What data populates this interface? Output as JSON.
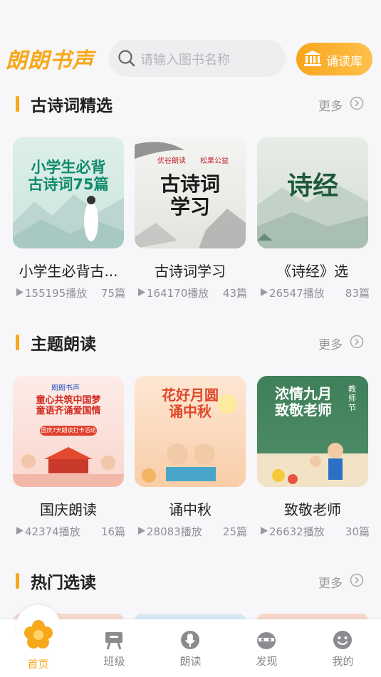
{
  "header": {
    "logo": "朗朗书声",
    "search_placeholder": "请输入图书名称",
    "library_label": "诵读库"
  },
  "sections": [
    {
      "title": "古诗词精选",
      "more": "更多",
      "books": [
        {
          "title": "小学生必背古...",
          "plays": "155195播放",
          "count": "75篇",
          "cover_text": "小学生必背\n古诗词75篇"
        },
        {
          "title": "古诗词学习",
          "plays": "164170播放",
          "count": "43篇",
          "cover_text": "古诗词\n学习",
          "cover_brand_a": "优谷朗读",
          "cover_brand_b": "松果公益"
        },
        {
          "title": "《诗经》选",
          "plays": "26547播放",
          "count": "83篇",
          "cover_text": "诗经"
        }
      ]
    },
    {
      "title": "主题朗读",
      "more": "更多",
      "books": [
        {
          "title": "国庆朗读",
          "plays": "42374播放",
          "count": "16篇",
          "cover_text": "童心共筑中国梦\n童语齐诵爱国情",
          "cover_badge": "朗朗书声",
          "cover_sub": "国庆7天朗读打卡活动"
        },
        {
          "title": "诵中秋",
          "plays": "28083播放",
          "count": "25篇",
          "cover_text": "花好月圆\n诵中秋"
        },
        {
          "title": "致敬老师",
          "plays": "26632播放",
          "count": "30篇",
          "cover_text": "浓情九月\n致敬老师",
          "cover_side": "教师节"
        }
      ]
    },
    {
      "title": "热门选读",
      "more": "更多",
      "books": []
    }
  ],
  "tabs": [
    {
      "label": "首页",
      "icon": "flower-icon",
      "active": true
    },
    {
      "label": "班级",
      "icon": "class-icon"
    },
    {
      "label": "朗读",
      "icon": "microphone-icon"
    },
    {
      "label": "发现",
      "icon": "discover-icon"
    },
    {
      "label": "我的",
      "icon": "smile-face-icon"
    }
  ],
  "colors": {
    "accent": "#f7a81b",
    "background": "#f7f6f9",
    "muted": "#999999"
  }
}
